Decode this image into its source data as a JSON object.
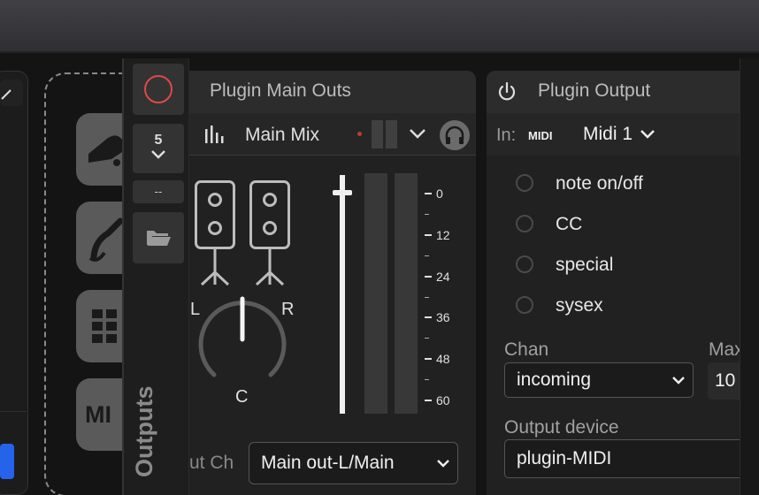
{
  "outputs_strip": {
    "label": "Outputs",
    "count_value": "5",
    "dash_label": "--"
  },
  "main_outs": {
    "title": "Plugin Main Outs",
    "mix_name": "Main Mix",
    "speaker_left": "L",
    "speaker_right": "R",
    "pan_center": "C",
    "meter_ticks": [
      "0",
      "12",
      "24",
      "36",
      "48",
      "60"
    ],
    "out_ch_label": "ut Ch",
    "out_ch_value": "Main out-L/Main"
  },
  "plugin_output": {
    "title": "Plugin Output",
    "in_label": "In:",
    "midi_badge": "MIDI",
    "midi_input": "Midi 1",
    "filters": [
      "note on/off",
      "CC",
      "special",
      "sysex"
    ],
    "chan_label": "Chan",
    "chan_value": "incoming",
    "max_label": "Max",
    "max_value": "10",
    "device_label": "Output device",
    "device_value": "plugin-MIDI"
  },
  "dropzone_tiles": [
    {
      "icon": "microphone-icon"
    },
    {
      "icon": "cable-icon"
    },
    {
      "icon": "grid-icon"
    },
    {
      "icon": "midi-icon",
      "label": "MI"
    }
  ],
  "colors": {
    "record": "#e04848",
    "accent_blue": "#2563eb",
    "level_dot": "#c03a3a"
  }
}
